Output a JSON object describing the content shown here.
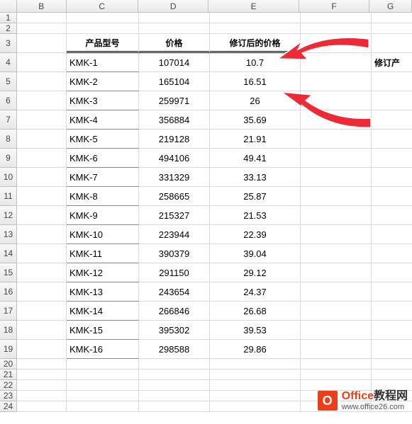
{
  "columns": [
    "B",
    "C",
    "D",
    "E",
    "F",
    "G"
  ],
  "row_numbers": [
    1,
    2,
    3,
    4,
    5,
    6,
    7,
    8,
    9,
    10,
    11,
    12,
    13,
    14,
    15,
    16,
    17,
    18,
    19,
    20,
    21,
    22,
    23,
    24
  ],
  "headers": {
    "model": "产品型号",
    "price": "价格",
    "revised": "修订后的价格"
  },
  "side_text": "修订产",
  "rows": [
    {
      "model": "KMK-1",
      "price": "107014",
      "revised": "10.7"
    },
    {
      "model": "KMK-2",
      "price": "165104",
      "revised": "16.51"
    },
    {
      "model": "KMK-3",
      "price": "259971",
      "revised": "26"
    },
    {
      "model": "KMK-4",
      "price": "356884",
      "revised": "35.69"
    },
    {
      "model": "KMK-5",
      "price": "219128",
      "revised": "21.91"
    },
    {
      "model": "KMK-6",
      "price": "494106",
      "revised": "49.41"
    },
    {
      "model": "KMK-7",
      "price": "331329",
      "revised": "33.13"
    },
    {
      "model": "KMK-8",
      "price": "258665",
      "revised": "25.87"
    },
    {
      "model": "KMK-9",
      "price": "215327",
      "revised": "21.53"
    },
    {
      "model": "KMK-10",
      "price": "223944",
      "revised": "22.39"
    },
    {
      "model": "KMK-11",
      "price": "390379",
      "revised": "39.04"
    },
    {
      "model": "KMK-12",
      "price": "291150",
      "revised": "29.12"
    },
    {
      "model": "KMK-13",
      "price": "243654",
      "revised": "24.37"
    },
    {
      "model": "KMK-14",
      "price": "266846",
      "revised": "26.68"
    },
    {
      "model": "KMK-15",
      "price": "395302",
      "revised": "39.53"
    },
    {
      "model": "KMK-16",
      "price": "298588",
      "revised": "29.86"
    }
  ],
  "watermark": {
    "brand_en": "Office",
    "brand_cn": "教程网",
    "url": "www.office26.com"
  },
  "row_heights": {
    "short": 15,
    "tall": 27
  },
  "chart_data": {
    "type": "table",
    "title": "",
    "columns": [
      "产品型号",
      "价格",
      "修订后的价格"
    ],
    "data": [
      [
        "KMK-1",
        107014,
        10.7
      ],
      [
        "KMK-2",
        165104,
        16.51
      ],
      [
        "KMK-3",
        259971,
        26
      ],
      [
        "KMK-4",
        356884,
        35.69
      ],
      [
        "KMK-5",
        219128,
        21.91
      ],
      [
        "KMK-6",
        494106,
        49.41
      ],
      [
        "KMK-7",
        331329,
        33.13
      ],
      [
        "KMK-8",
        258665,
        25.87
      ],
      [
        "KMK-9",
        215327,
        21.53
      ],
      [
        "KMK-10",
        223944,
        22.39
      ],
      [
        "KMK-11",
        390379,
        39.04
      ],
      [
        "KMK-12",
        291150,
        29.12
      ],
      [
        "KMK-13",
        243654,
        24.37
      ],
      [
        "KMK-14",
        266846,
        26.68
      ],
      [
        "KMK-15",
        395302,
        39.53
      ],
      [
        "KMK-16",
        298588,
        29.86
      ]
    ]
  }
}
